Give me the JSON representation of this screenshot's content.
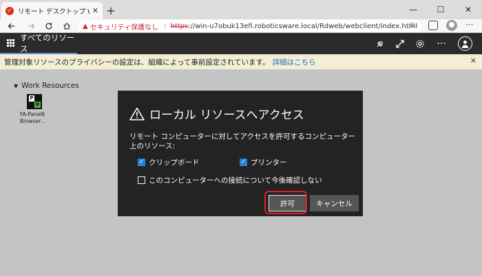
{
  "browser": {
    "tab_title": "リモート デスクトップ Web クライアント",
    "new_tab": "+",
    "controls": {
      "minimize": "—",
      "maximize": "☐",
      "close": "✕"
    },
    "security_warning": "セキュリティ保護なし",
    "url_scheme": "https",
    "url_rest": "://win-u7obuk13efi.roboticsware.local/Rdweb/webclient/index.html"
  },
  "app": {
    "nav_tab": "すべてのリソース"
  },
  "banner": {
    "text": "管理対象リソースのプライバシーの設定は、組織によって事前設定されています。",
    "link": "詳細はこちら"
  },
  "workspace": {
    "group": "Work Resources",
    "resources": [
      {
        "name_line1": "FA-Panel6",
        "name_line2": "Browser...",
        "icon_left": "P",
        "icon_right": "B"
      }
    ]
  },
  "dialog": {
    "title": "ローカル リソースへアクセス",
    "description": "リモート コンピューターに対してアクセスを許可するコンピューター上のリソース:",
    "options": {
      "clipboard": {
        "label": "クリップボード",
        "checked": true
      },
      "printer": {
        "label": "プリンター",
        "checked": true
      },
      "dont_ask": {
        "label": "このコンピューターへの接続について今後確認しない",
        "checked": false
      }
    },
    "allow_button": "許可",
    "cancel_button": "キャンセル"
  },
  "colors": {
    "accent": "#2d7fd3",
    "highlight": "#e51f26",
    "dialog_bg": "#232323",
    "header_bg": "#2b2b2b",
    "banner_bg": "#f3efd7"
  }
}
